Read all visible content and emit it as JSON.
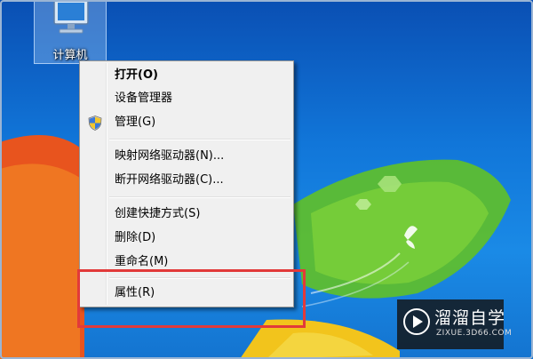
{
  "desktop": {
    "computer_icon_label": "计算机"
  },
  "context_menu": {
    "items": [
      {
        "label": "打开(O)",
        "bold": true
      },
      {
        "label": "设备管理器"
      },
      {
        "label": "管理(G)",
        "icon": "uac-shield-icon"
      },
      {
        "label": "映射网络驱动器(N)..."
      },
      {
        "label": "断开网络驱动器(C)..."
      },
      {
        "label": "创建快捷方式(S)"
      },
      {
        "label": "删除(D)"
      },
      {
        "label": "重命名(M)"
      },
      {
        "label": "属性(R)"
      }
    ]
  },
  "highlight": {
    "color": "#e23a3a",
    "target": "属性(R)"
  },
  "watermark": {
    "title": "溜溜自学",
    "url": "ZIXUE.3D66.COM"
  },
  "colors": {
    "desktop_blue": "#1176d9",
    "menu_background": "#f0f0f0",
    "highlight_red": "#e23a3a"
  }
}
